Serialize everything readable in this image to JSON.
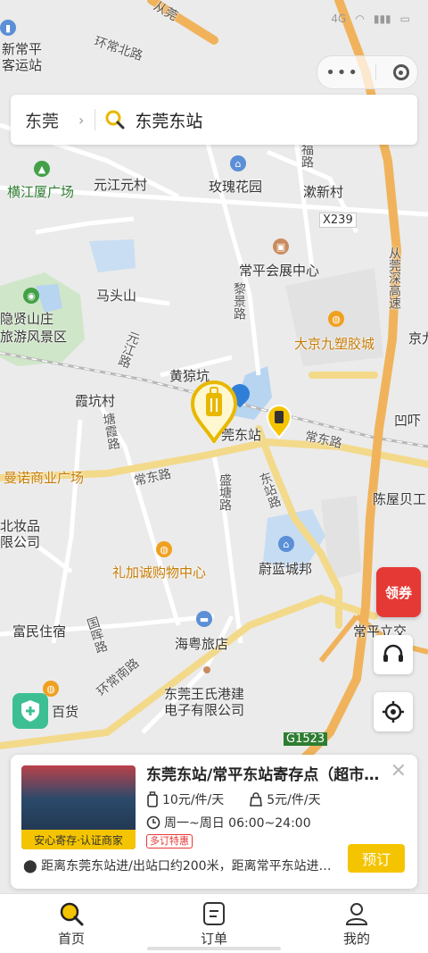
{
  "status_bar": {
    "network": "4G"
  },
  "search": {
    "city": "东莞",
    "query": "东莞东站"
  },
  "map_labels": {
    "xinchangping": "新常平",
    "keyunzhan": "客运站",
    "huanchang_north": "环常北路",
    "congguan": "从莞",
    "hengjiangsha": "横江厦广场",
    "yuanjiang": "元江元村",
    "meigui": "玫瑰花园",
    "suxin": "漱新村",
    "fu_road": "福路",
    "x239": "X239",
    "congguan_shen": "从莞深高速",
    "changping_expo": "常平会展中心",
    "matoushan": "马头山",
    "yinxian1": "隐贤山庄",
    "yinxian2": "旅游风景区",
    "lijing": "黎景路",
    "dajing": "大京九塑胶城",
    "jing": "京九",
    "yuanjing_road": "元江路",
    "huangyuankeng": "黄猄坑",
    "xiakeng": "霞坑村",
    "dongguan_east": "莞东站",
    "changdong_right": "常东路",
    "aochui": "凹吓",
    "tangxia": "塘霞路",
    "mannuo": "曼诺商业广场",
    "changdong_left": "常东路",
    "shengtang": "盛塘路",
    "dongzhan_road": "东站路",
    "chenwubei": "陈屋贝工",
    "cosmetics1": "北妆品",
    "cosmetics2": "限公司",
    "lijiacheng": "礼加诚购物中心",
    "weilan": "蔚蓝城邦",
    "guohui": "国晖路",
    "fumin": "富民住宿",
    "haiyue": "海粤旅店",
    "huanchang_south": "环常南路",
    "baihuo": "百货",
    "wangshi1": "东莞王氏港建",
    "wangshi2": "电子有限公司",
    "changping_li": "常平立交",
    "g1523": "G1523"
  },
  "coupon": {
    "label": "领券"
  },
  "card": {
    "title": "东莞东站/常平东站寄存点（超市…",
    "badge": "安心寄存·认证商家",
    "price_large": "10元/件/天",
    "price_small": "5元/件/天",
    "hours": "周一~周日 06:00~24:00",
    "tag": "多订特惠",
    "distance": "距离东莞东站进/出站口约200米，距离常平东站进…",
    "book": "预订"
  },
  "tabs": [
    {
      "label": "首页",
      "icon": "search-icon"
    },
    {
      "label": "订单",
      "icon": "order-icon"
    },
    {
      "label": "我的",
      "icon": "user-icon"
    }
  ],
  "colors": {
    "accent": "#f5c400",
    "coupon": "#e53935",
    "highway": "#f0b35c"
  }
}
